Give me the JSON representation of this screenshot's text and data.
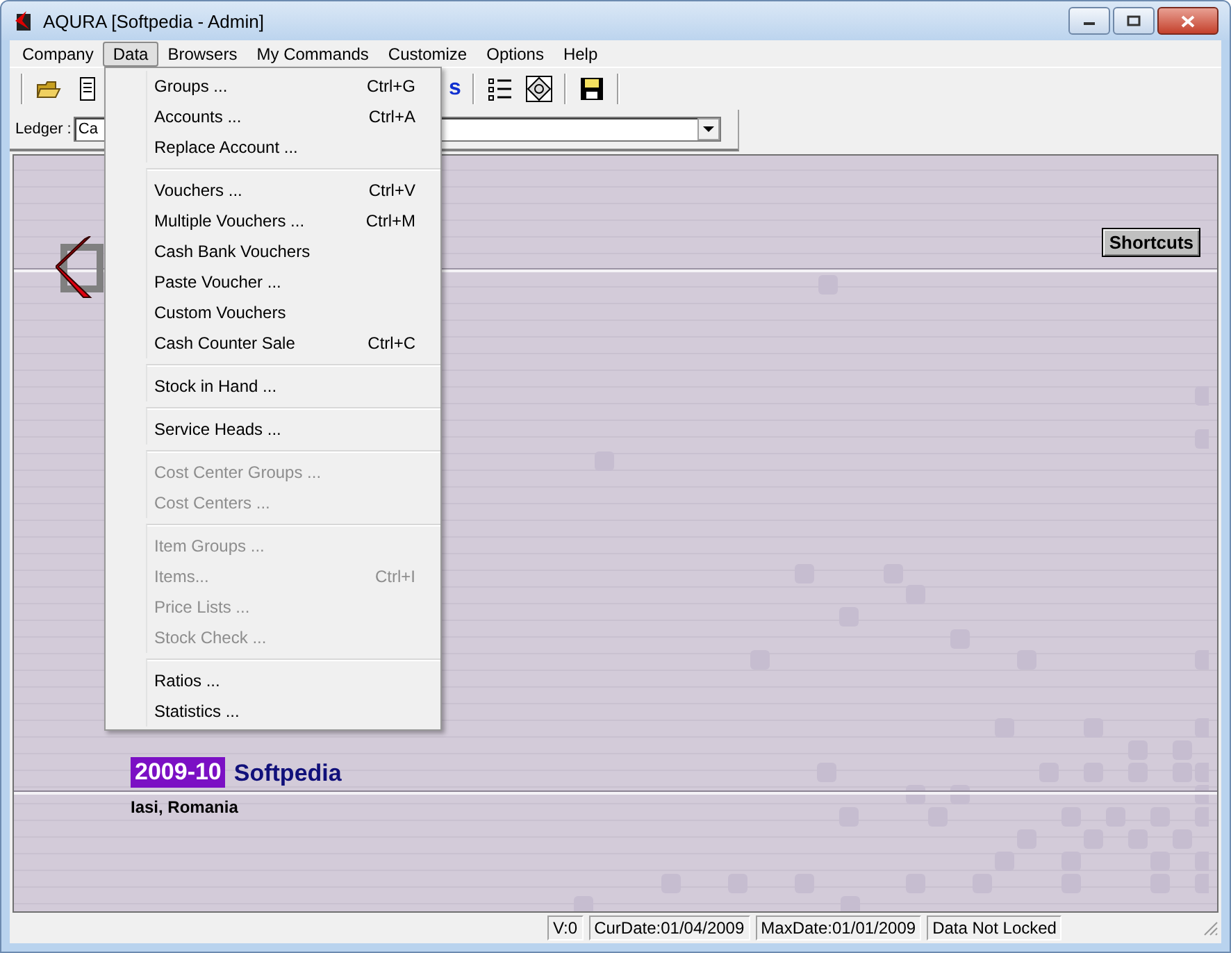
{
  "window": {
    "title": "AQURA [Softpedia - Admin]"
  },
  "menu_bar": [
    {
      "label": "Company",
      "selected": false
    },
    {
      "label": "Data",
      "selected": true
    },
    {
      "label": "Browsers",
      "selected": false
    },
    {
      "label": "My Commands",
      "selected": false
    },
    {
      "label": "Customize",
      "selected": false
    },
    {
      "label": "Options",
      "selected": false
    },
    {
      "label": "Help",
      "selected": false
    }
  ],
  "toolbar": {
    "partial_text": "s"
  },
  "ledger_bar": {
    "label": "Ledger :",
    "value": "Ca"
  },
  "data_menu": {
    "groups": [
      [
        {
          "label": "Groups ...",
          "shortcut": "Ctrl+G",
          "disabled": false
        },
        {
          "label": "Accounts ...",
          "shortcut": "Ctrl+A",
          "disabled": false
        },
        {
          "label": "Replace Account ...",
          "disabled": false
        }
      ],
      [
        {
          "label": "Vouchers ...",
          "shortcut": "Ctrl+V",
          "disabled": false
        },
        {
          "label": "Multiple Vouchers ...",
          "shortcut": "Ctrl+M",
          "disabled": false
        },
        {
          "label": "Cash Bank Vouchers",
          "disabled": false
        },
        {
          "label": "Paste Voucher ...",
          "disabled": false
        },
        {
          "label": "Custom Vouchers",
          "disabled": false
        },
        {
          "label": "Cash Counter Sale",
          "shortcut": "Ctrl+C",
          "disabled": false
        }
      ],
      [
        {
          "label": "Stock in Hand ...",
          "disabled": false
        }
      ],
      [
        {
          "label": "Service Heads ...",
          "disabled": false
        }
      ],
      [
        {
          "label": "Cost Center Groups ...",
          "disabled": true
        },
        {
          "label": "Cost Centers ...",
          "disabled": true
        }
      ],
      [
        {
          "label": "Item Groups ...",
          "disabled": true
        },
        {
          "label": "Items...",
          "shortcut": "Ctrl+I",
          "disabled": true
        },
        {
          "label": "Price Lists ...",
          "disabled": true
        },
        {
          "label": "Stock Check ...",
          "disabled": true
        }
      ],
      [
        {
          "label": "Ratios ...",
          "disabled": false
        },
        {
          "label": "Statistics ...",
          "disabled": false
        }
      ]
    ]
  },
  "workspace": {
    "shortcuts_button": "Shortcuts",
    "year": "2009-10",
    "company": "Softpedia",
    "location": "Iasi, Romania"
  },
  "status_bar": [
    "V:0",
    "CurDate:01/04/2009",
    "MaxDate:01/01/2009",
    "Data Not Locked"
  ]
}
